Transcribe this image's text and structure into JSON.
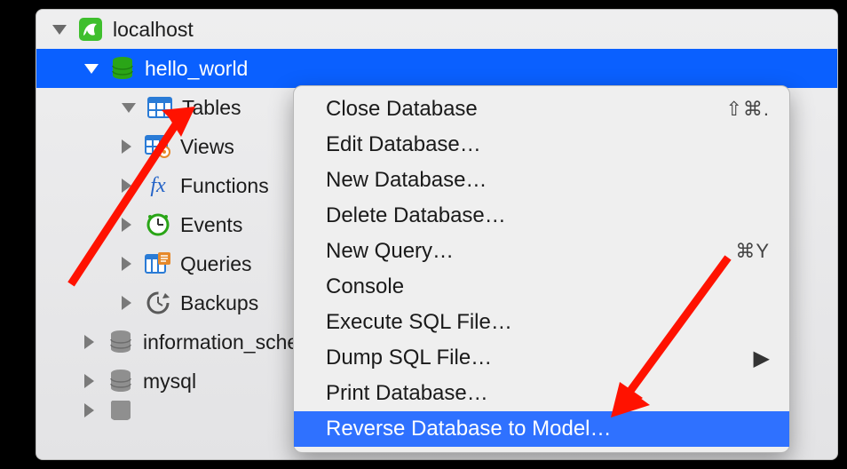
{
  "tree": {
    "root": {
      "label": "localhost"
    },
    "db_selected": {
      "label": "hello_world"
    },
    "children": [
      {
        "label": "Tables"
      },
      {
        "label": "Views"
      },
      {
        "label": "Functions"
      },
      {
        "label": "Events"
      },
      {
        "label": "Queries"
      },
      {
        "label": "Backups"
      }
    ],
    "other_dbs": [
      {
        "label": "information_schema"
      },
      {
        "label": "mysql"
      }
    ]
  },
  "context_menu": {
    "items": [
      {
        "label": "Close Database",
        "shortcut": "⇧⌘."
      },
      {
        "label": "Edit Database…"
      },
      {
        "label": "New Database…"
      },
      {
        "label": "Delete Database…"
      },
      {
        "label": "New Query…",
        "shortcut": "⌘Y"
      },
      {
        "label": "Console"
      },
      {
        "label": "Execute SQL File…"
      },
      {
        "label": "Dump SQL File…",
        "submenu": true
      },
      {
        "label": "Print Database…"
      },
      {
        "label": "Reverse Database to Model…",
        "highlighted": true
      }
    ]
  },
  "colors": {
    "selection": "#0a60ff",
    "menu_highlight": "#2f71ff",
    "arrow": "#ff1200"
  }
}
